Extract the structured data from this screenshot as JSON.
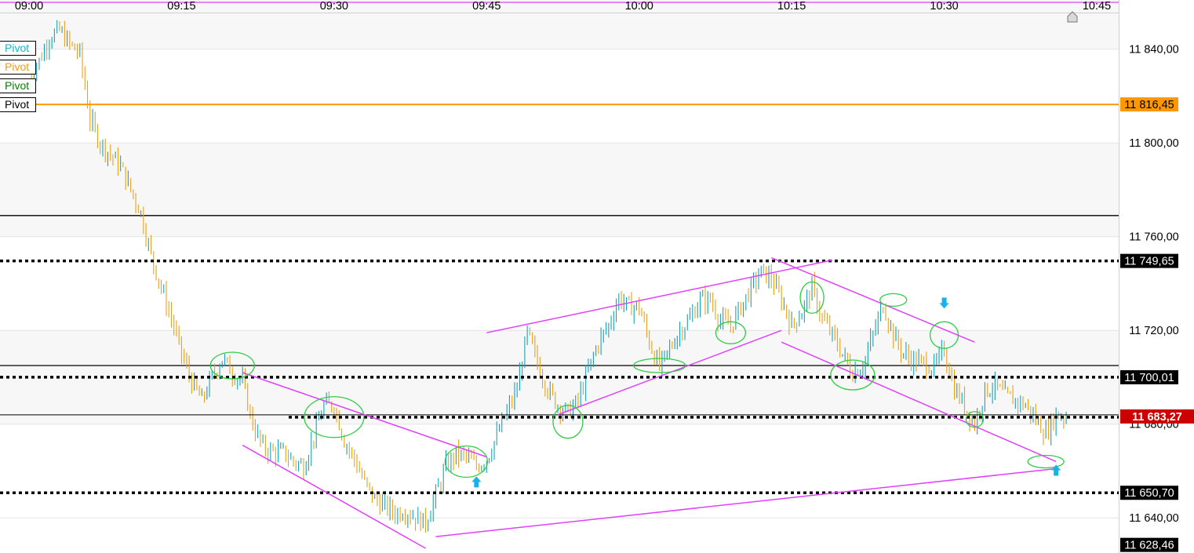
{
  "chart_data": {
    "type": "candlestick",
    "x_ticks": [
      "09:00",
      "09:15",
      "09:30",
      "09:45",
      "10:00",
      "10:15",
      "10:30",
      "10:45"
    ],
    "y_ticks": [
      "11 840,00",
      "11 800,00",
      "11 760,00",
      "11 720,00",
      "11 680,00",
      "11 640,00"
    ],
    "y_tick_values": [
      11840,
      11800,
      11760,
      11720,
      11680,
      11640
    ],
    "ylim": [
      11625,
      11861
    ],
    "legend": [
      {
        "label": "Pivot",
        "color": "#00bcd4"
      },
      {
        "label": "Pivot",
        "color": "#ff9800"
      },
      {
        "label": "Pivot",
        "color": "#008000"
      },
      {
        "label": "Pivot",
        "color": "#000000"
      }
    ],
    "price_levels": [
      {
        "label": "11 816,45",
        "value": 11816.45,
        "color": "#ff9800",
        "style": "solid",
        "badge_bg": "#ff9800",
        "badge_fg": "#000000"
      },
      {
        "label": "11 749,65",
        "value": 11749.65,
        "color": "#000000",
        "style": "dotted",
        "badge_bg": "#000000",
        "badge_fg": "#ffffff"
      },
      {
        "label": "11 700,01",
        "value": 11700.01,
        "color": "#000000",
        "style": "dotted",
        "badge_bg": "#000000",
        "badge_fg": "#ffffff"
      },
      {
        "label": "11 683,27",
        "value": 11683.27,
        "color": "#000000",
        "style": "solid-dotted",
        "badge_bg": "#cc0000",
        "badge_fg": "#ffffff"
      },
      {
        "label": "11 650,70",
        "value": 11650.7,
        "color": "#000000",
        "style": "dotted",
        "badge_bg": "#000000",
        "badge_fg": "#ffffff"
      },
      {
        "label": "11 628,46",
        "value": 11628.46,
        "color": "#000000",
        "style": "none",
        "badge_bg": "#000000",
        "badge_fg": "#ffffff"
      }
    ],
    "horizontal_lines": [
      {
        "value": 11860,
        "color": "#e040fb"
      },
      {
        "value": 11769,
        "color": "#000000"
      },
      {
        "value": 11705,
        "color": "#000000"
      }
    ],
    "trend_lines": [
      {
        "from": [
          "09:21",
          11702
        ],
        "to": [
          "09:45",
          11666
        ]
      },
      {
        "from": [
          "09:21",
          11671
        ],
        "to": [
          "09:39",
          11627
        ]
      },
      {
        "from": [
          "09:45",
          11719
        ],
        "to": [
          "10:19",
          11750
        ]
      },
      {
        "from": [
          "09:52",
          11684
        ],
        "to": [
          "10:14",
          11720
        ]
      },
      {
        "from": [
          "10:13",
          11751
        ],
        "to": [
          "10:33",
          11715
        ]
      },
      {
        "from": [
          "10:14",
          11715
        ],
        "to": [
          "10:41",
          11664
        ]
      },
      {
        "from": [
          "09:40",
          11632
        ],
        "to": [
          "10:41",
          11661
        ]
      }
    ],
    "highlight_ellipses": [
      {
        "at": [
          "09:20",
          11705
        ]
      },
      {
        "at": [
          "09:30",
          11683
        ]
      },
      {
        "at": [
          "09:43",
          11664
        ]
      },
      {
        "at": [
          "09:53",
          11681
        ]
      },
      {
        "at": [
          "10:02",
          11705
        ]
      },
      {
        "at": [
          "10:09",
          11719
        ]
      },
      {
        "at": [
          "10:17",
          11734
        ]
      },
      {
        "at": [
          "10:21",
          11701
        ]
      },
      {
        "at": [
          "10:25",
          11733
        ]
      },
      {
        "at": [
          "10:30",
          11718
        ]
      },
      {
        "at": [
          "10:33",
          11682
        ]
      },
      {
        "at": [
          "10:40",
          11664
        ]
      }
    ],
    "signals": [
      {
        "type": "up",
        "at": [
          "09:44",
          11655
        ]
      },
      {
        "type": "down",
        "at": [
          "10:30",
          11732
        ]
      },
      {
        "type": "up",
        "at": [
          "10:41",
          11660
        ]
      }
    ],
    "ohlc_path": [
      [
        "09:00",
        11830
      ],
      [
        "09:01",
        11835
      ],
      [
        "09:02",
        11845
      ],
      [
        "09:03",
        11848
      ],
      [
        "09:04",
        11842
      ],
      [
        "09:05",
        11838
      ],
      [
        "09:06",
        11810
      ],
      [
        "09:07",
        11800
      ],
      [
        "09:08",
        11795
      ],
      [
        "09:09",
        11790
      ],
      [
        "09:10",
        11780
      ],
      [
        "09:11",
        11770
      ],
      [
        "09:12",
        11752
      ],
      [
        "09:13",
        11738
      ],
      [
        "09:14",
        11725
      ],
      [
        "09:15",
        11710
      ],
      [
        "09:16",
        11698
      ],
      [
        "09:17",
        11690
      ],
      [
        "09:18",
        11700
      ],
      [
        "09:19",
        11708
      ],
      [
        "09:20",
        11702
      ],
      [
        "09:21",
        11698
      ],
      [
        "09:22",
        11680
      ],
      [
        "09:23",
        11670
      ],
      [
        "09:24",
        11668
      ],
      [
        "09:25",
        11668
      ],
      [
        "09:26",
        11664
      ],
      [
        "09:27",
        11662
      ],
      [
        "09:28",
        11675
      ],
      [
        "09:29",
        11688
      ],
      [
        "09:30",
        11688
      ],
      [
        "09:31",
        11673
      ],
      [
        "09:32",
        11665
      ],
      [
        "09:33",
        11655
      ],
      [
        "09:34",
        11648
      ],
      [
        "09:35",
        11645
      ],
      [
        "09:36",
        11642
      ],
      [
        "09:37",
        11643
      ],
      [
        "09:38",
        11640
      ],
      [
        "09:39",
        11638
      ],
      [
        "09:40",
        11650
      ],
      [
        "09:41",
        11662
      ],
      [
        "09:42",
        11667
      ],
      [
        "09:43",
        11666
      ],
      [
        "09:44",
        11662
      ],
      [
        "09:45",
        11665
      ],
      [
        "09:46",
        11675
      ],
      [
        "09:47",
        11685
      ],
      [
        "09:48",
        11695
      ],
      [
        "09:49",
        11719
      ],
      [
        "09:50",
        11706
      ],
      [
        "09:51",
        11695
      ],
      [
        "09:52",
        11688
      ],
      [
        "09:53",
        11685
      ],
      [
        "09:54",
        11690
      ],
      [
        "09:55",
        11703
      ],
      [
        "09:56",
        11715
      ],
      [
        "09:57",
        11722
      ],
      [
        "09:58",
        11734
      ],
      [
        "09:59",
        11730
      ],
      [
        "10:00",
        11730
      ],
      [
        "10:01",
        11715
      ],
      [
        "10:02",
        11704
      ],
      [
        "10:03",
        11712
      ],
      [
        "10:04",
        11720
      ],
      [
        "10:05",
        11725
      ],
      [
        "10:06",
        11733
      ],
      [
        "10:07",
        11733
      ],
      [
        "10:08",
        11724
      ],
      [
        "10:09",
        11722
      ],
      [
        "10:10",
        11730
      ],
      [
        "10:11",
        11738
      ],
      [
        "10:12",
        11745
      ],
      [
        "10:13",
        11742
      ],
      [
        "10:14",
        11733
      ],
      [
        "10:15",
        11722
      ],
      [
        "10:16",
        11728
      ],
      [
        "10:17",
        11738
      ],
      [
        "10:18",
        11725
      ],
      [
        "10:19",
        11718
      ],
      [
        "10:20",
        11710
      ],
      [
        "10:21",
        11702
      ],
      [
        "10:22",
        11705
      ],
      [
        "10:23",
        11718
      ],
      [
        "10:24",
        11731
      ],
      [
        "10:25",
        11718
      ],
      [
        "10:26",
        11710
      ],
      [
        "10:27",
        11707
      ],
      [
        "10:28",
        11706
      ],
      [
        "10:29",
        11704
      ],
      [
        "10:30",
        11712
      ],
      [
        "10:31",
        11695
      ],
      [
        "10:32",
        11688
      ],
      [
        "10:33",
        11680
      ],
      [
        "10:34",
        11694
      ],
      [
        "10:35",
        11696
      ],
      [
        "10:36",
        11692
      ],
      [
        "10:37",
        11690
      ],
      [
        "10:38",
        11688
      ],
      [
        "10:39",
        11682
      ],
      [
        "10:40",
        11676
      ],
      [
        "10:41",
        11684
      ],
      [
        "10:42",
        11683
      ]
    ],
    "home_marker": "10:45"
  }
}
